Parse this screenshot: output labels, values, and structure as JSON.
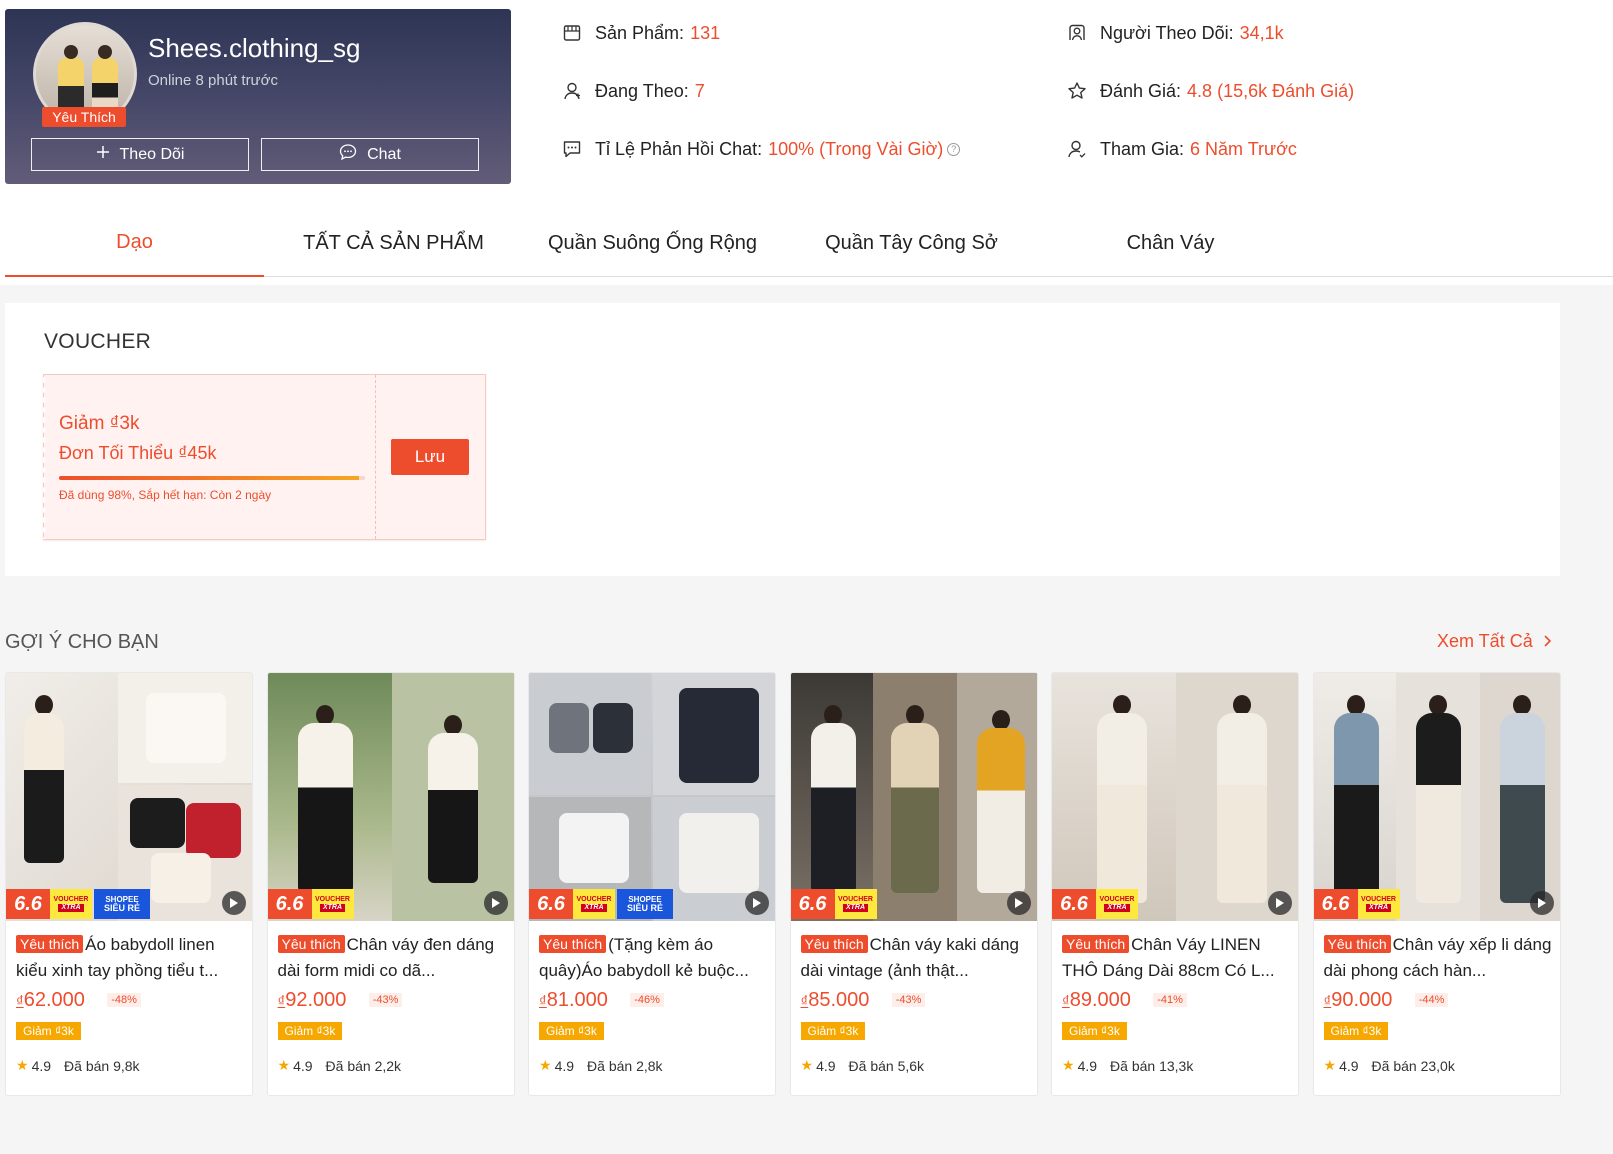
{
  "shop": {
    "name": "Shees.clothing_sg",
    "online": "Online 8 phút trước",
    "badge": "Yêu Thích",
    "follow_label": "Theo Dõi",
    "chat_label": "Chat"
  },
  "stats": {
    "products_label": "Sản Phẩm:",
    "products_value": "131",
    "following_label": "Đang Theo:",
    "following_value": "7",
    "chat_rate_label": "Tỉ Lệ Phản Hồi Chat:",
    "chat_rate_value": "100% (Trong Vài Giờ)",
    "followers_label": "Người Theo Dõi:",
    "followers_value": "34,1k",
    "rating_label": "Đánh Giá:",
    "rating_value": "4.8 (15,6k Đánh Giá)",
    "joined_label": "Tham Gia:",
    "joined_value": "6 Năm Trước"
  },
  "tabs": [
    "Dạo",
    "TẤT CẢ SẢN PHẨM",
    "Quần Suông Ống Rộng",
    "Quần Tây Công Sở",
    "Chân Váy"
  ],
  "voucher": {
    "title": "VOUCHER",
    "amount": "Giảm ₫3k",
    "min_order": "Đơn Tối Thiểu ₫45k",
    "used_fraction": 0.98,
    "note": "Đã dùng 98%, Sắp hết hạn: Còn 2 ngày",
    "save_label": "Lưu"
  },
  "suggest": {
    "title": "GỢI Ý CHO BẠN",
    "see_all": "Xem Tất Cả"
  },
  "colors": {
    "accent": "#ee4d2d",
    "rating_star": "#f6a700"
  },
  "products": [
    {
      "tag": "Yêu thích",
      "name": "Áo babydoll linen kiểu xinh tay phồng tiểu t...",
      "currency": "₫",
      "price": "62.000",
      "discount": "-48%",
      "voucher": "Giảm ₫3k",
      "rating": "4.9",
      "sold": "Đã bán 9,8k",
      "shopee_badge": true
    },
    {
      "tag": "Yêu thích",
      "name": "Chân váy đen dáng dài form midi co dã...",
      "currency": "₫",
      "price": "92.000",
      "discount": "-43%",
      "voucher": "Giảm ₫3k",
      "rating": "4.9",
      "sold": "Đã bán 2,2k",
      "shopee_badge": false
    },
    {
      "tag": "Yêu thích",
      "name": "(Tặng kèm áo quây)Áo babydoll kẻ buộc...",
      "currency": "₫",
      "price": "81.000",
      "discount": "-46%",
      "voucher": "Giảm ₫3k",
      "rating": "4.9",
      "sold": "Đã bán 2,8k",
      "shopee_badge": true
    },
    {
      "tag": "Yêu thích",
      "name": "Chân váy kaki dáng dài vintage (ảnh thật...",
      "currency": "₫",
      "price": "85.000",
      "discount": "-43%",
      "voucher": "Giảm ₫3k",
      "rating": "4.9",
      "sold": "Đã bán 5,6k",
      "shopee_badge": false
    },
    {
      "tag": "Yêu thích",
      "name": "Chân Váy LINEN THÔ Dáng Dài 88cm Có L...",
      "currency": "₫",
      "price": "89.000",
      "discount": "-41%",
      "voucher": "Giảm ₫3k",
      "rating": "4.9",
      "sold": "Đã bán 13,3k",
      "shopee_badge": false
    },
    {
      "tag": "Yêu thích",
      "name": "Chân váy xếp li dáng dài phong cách hàn...",
      "currency": "₫",
      "price": "90.000",
      "discount": "-44%",
      "voucher": "Giảm ₫3k",
      "rating": "4.9",
      "sold": "Đã bán 23,0k",
      "shopee_badge": false
    }
  ],
  "badges": {
    "sale": "6.6",
    "voucher_top": "VOUCHER",
    "voucher_bottom": "XTRA",
    "shopee_top": "SHOPEE",
    "shopee_bottom": "SIÊU RẺ"
  }
}
